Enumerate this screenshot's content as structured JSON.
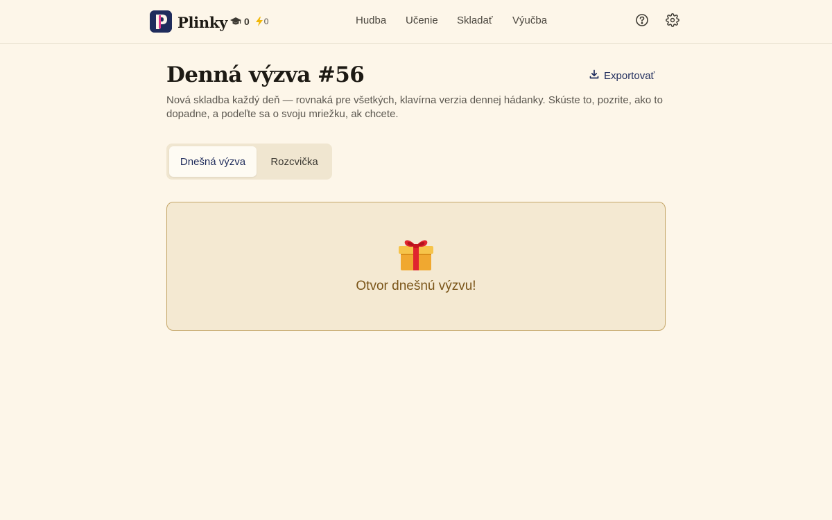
{
  "brand": {
    "name": "Plinky",
    "logo_letter": "P",
    "logo_color": "#1f2c5c",
    "logo_accent": "#e0338c"
  },
  "stats": {
    "learned_icon": "graduation-cap-icon",
    "learned": "0",
    "streak_icon": "lightning-icon",
    "streak": "0"
  },
  "nav": {
    "items": [
      "Hudba",
      "Učenie",
      "Skladať",
      "Výučba"
    ]
  },
  "header_icons": [
    "help-circle-icon",
    "gear-icon"
  ],
  "page": {
    "title": "Denná výzva #56",
    "export_icon": "download-icon",
    "export_label": "Exportovať",
    "subtitle": "Nová skladba každý deň — rovnaká pre všetkých, klavírna verzia dennej hádanky. Skúste to, pozrite, ako to dopadne, a podeľte sa o svoju mriežku, ak chcete."
  },
  "tabs": [
    {
      "label": "Dnešná výzva",
      "active": true
    },
    {
      "label": "Rozcvička",
      "active": false
    }
  ],
  "challenge_card": {
    "icon": "gift-icon",
    "label": "Otvor dnešnú výzvu!"
  },
  "colors": {
    "background": "#fdf6e9",
    "accent": "#1f2c5c",
    "card_bg": "#f4e9d2",
    "card_border": "#c4a567",
    "card_text": "#7a5519"
  }
}
